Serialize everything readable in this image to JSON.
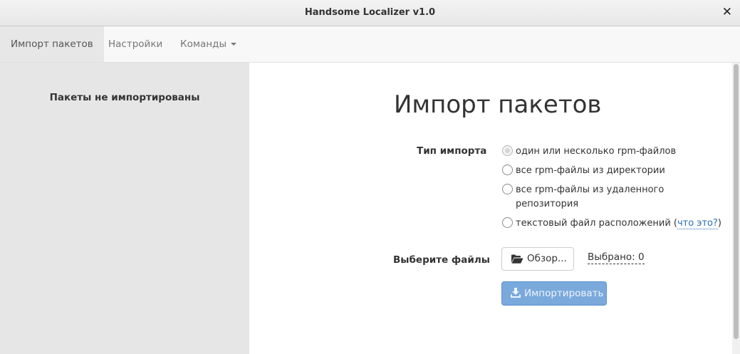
{
  "window": {
    "title": "Handsome Localizer v1.0",
    "close_glyph": "✕"
  },
  "navbar": {
    "items": [
      {
        "label": "Импорт пакетов",
        "active": true
      },
      {
        "label": "Настройки",
        "active": false
      },
      {
        "label": "Команды",
        "active": false,
        "dropdown": true
      }
    ]
  },
  "sidebar": {
    "empty_text": "Пакеты не импортированы"
  },
  "main": {
    "title": "Импорт пакетов",
    "import_type": {
      "label": "Тип импорта",
      "options": [
        {
          "text": "один или несколько rpm-файлов",
          "checked": true
        },
        {
          "text": "все rpm-файлы из директории",
          "checked": false
        },
        {
          "text_line1": "все rpm-файлы из удаленного",
          "text_line2": "репозитория",
          "checked": false
        },
        {
          "text_before": "текстовый файл расположений (",
          "link": "что это?",
          "text_after": ")",
          "checked": false
        }
      ]
    },
    "files": {
      "label": "Выберите файлы",
      "browse_label": "Обзор...",
      "selected_text": "Выбрано: 0"
    },
    "import_button_label": "Импортировать"
  },
  "icons": {
    "folder": "folder-open-icon",
    "download": "download-icon"
  },
  "colors": {
    "accent": "#7aa9dc",
    "link": "#2a6fb5",
    "sidebar_bg": "#e6e6e6",
    "navbar_bg": "#f8f8f8"
  }
}
